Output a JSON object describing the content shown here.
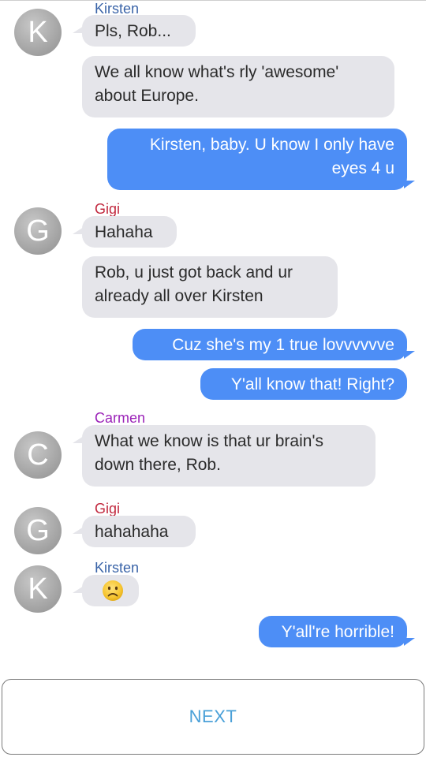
{
  "messages": [
    {
      "sender": "Kirsten",
      "avatar": "K",
      "text": "Pls, Rob..."
    },
    {
      "text": "We all know what's rly 'awesome'\nabout Europe."
    },
    {
      "outgoing": true,
      "text": "Kirsten, baby. U know I only have\neyes 4 u"
    },
    {
      "sender": "Gigi",
      "avatar": "G",
      "text": "Hahaha"
    },
    {
      "text": "Rob, u just got back and ur\nalready all over Kirsten"
    },
    {
      "outgoing": true,
      "text": "Cuz she's my 1 true lovvvvvve"
    },
    {
      "outgoing": true,
      "text": "Y'all know that! Right?"
    },
    {
      "sender": "Carmen",
      "avatar": "C",
      "text": "What we know is that ur brain's\ndown there, Rob."
    },
    {
      "sender": "Gigi",
      "avatar": "G",
      "text": "hahahaha"
    },
    {
      "sender": "Kirsten",
      "avatar": "K",
      "icon": "frowning-face-emoji"
    },
    {
      "outgoing": true,
      "text": "Y'all're horrible!"
    }
  ],
  "next_label": "NEXT",
  "colors": {
    "kirsten": "#3a64a8",
    "gigi": "#c1273d",
    "carmen": "#9b22b8",
    "incoming_bubble": "#e5e5ea",
    "outgoing_bubble": "#4d8ef6",
    "next_text": "#4aa0d8"
  }
}
